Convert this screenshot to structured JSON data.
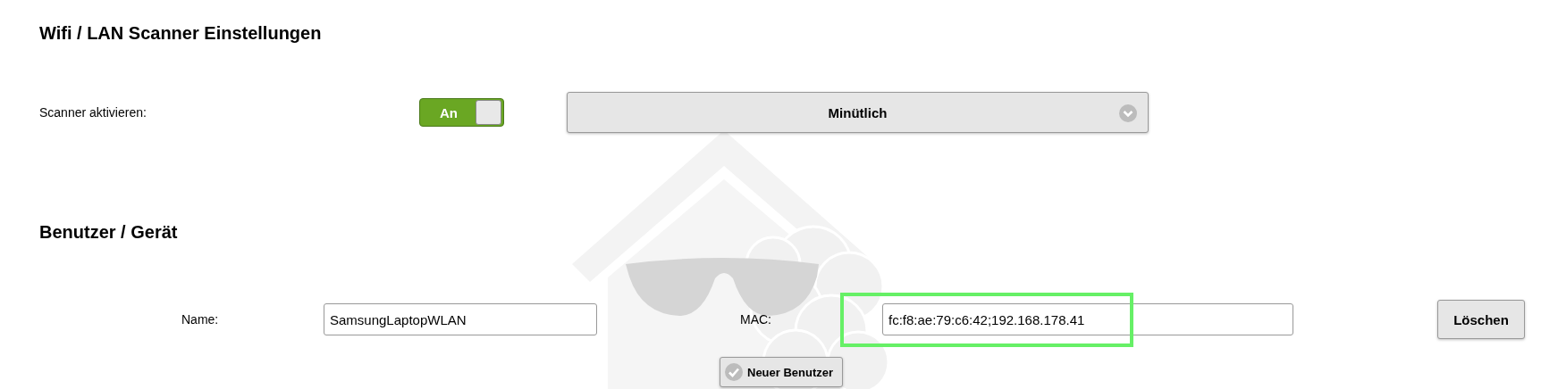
{
  "scanner_section": {
    "heading": "Wifi / LAN Scanner Einstellungen",
    "activate_label": "Scanner aktivieren:",
    "toggle": {
      "label": "An",
      "on": true
    },
    "interval_dropdown": {
      "value": "Minütlich"
    }
  },
  "user_section": {
    "heading": "Benutzer / Gerät",
    "name_field": {
      "label": "Name:",
      "value": "SamsungLaptopWLAN"
    },
    "mac_field": {
      "label": "MAC:",
      "value": "fc:f8:ae:79:c6:42;192.168.178.41",
      "highlighted": true
    },
    "delete_button": "Löschen",
    "new_user_button": "Neuer Benutzer"
  }
}
